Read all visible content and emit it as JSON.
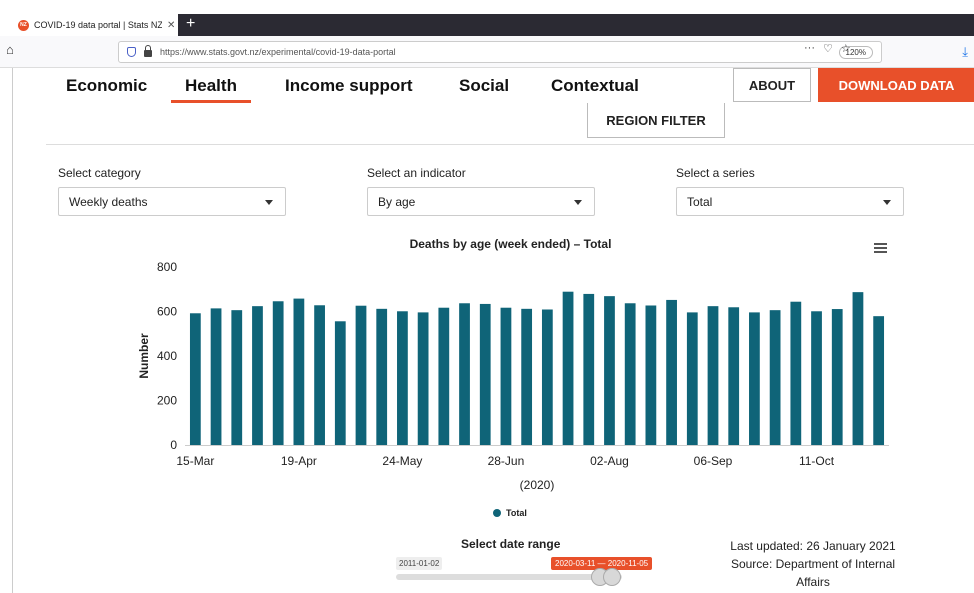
{
  "browser": {
    "tab_title": "COVID-19 data portal | Stats NZ",
    "tab_favicon": "NZ",
    "new_tab": "+",
    "url": "https://www.stats.govt.nz/experimental/covid-19-data-portal",
    "zoom": "120%"
  },
  "nav": {
    "tabs": [
      {
        "label": "Economic"
      },
      {
        "label": "Health",
        "active": true
      },
      {
        "label": "Income support"
      },
      {
        "label": "Social"
      },
      {
        "label": "Contextual"
      }
    ],
    "about": "ABOUT",
    "download": "DOWNLOAD DATA",
    "region_filter": "REGION FILTER"
  },
  "filters": {
    "category": {
      "label": "Select category",
      "value": "Weekly deaths"
    },
    "indicator": {
      "label": "Select an indicator",
      "value": "By age"
    },
    "series": {
      "label": "Select a series",
      "value": "Total"
    }
  },
  "chart_data": {
    "type": "bar",
    "title": "Deaths by age (week ended) – Total",
    "ylabel": "Number",
    "xlabel": "(2020)",
    "ylim": [
      0,
      800
    ],
    "yticks": [
      0,
      200,
      400,
      600,
      800
    ],
    "x_tick_labels": [
      "15-Mar",
      "19-Apr",
      "24-May",
      "28-Jun",
      "02-Aug",
      "06-Sep",
      "11-Oct"
    ],
    "x_tick_positions": [
      0,
      5,
      10,
      15,
      20,
      25,
      30
    ],
    "categories": [
      "15-Mar",
      "22-Mar",
      "29-Mar",
      "05-Apr",
      "12-Apr",
      "19-Apr",
      "26-Apr",
      "03-May",
      "10-May",
      "17-May",
      "24-May",
      "31-May",
      "07-Jun",
      "14-Jun",
      "21-Jun",
      "28-Jun",
      "05-Jul",
      "12-Jul",
      "19-Jul",
      "26-Jul",
      "02-Aug",
      "09-Aug",
      "16-Aug",
      "23-Aug",
      "30-Aug",
      "06-Sep",
      "13-Sep",
      "20-Sep",
      "27-Sep",
      "04-Oct",
      "11-Oct",
      "18-Oct",
      "25-Oct",
      "01-Nov"
    ],
    "series": [
      {
        "name": "Total",
        "color": "#0f6478",
        "values": [
          592,
          614,
          606,
          624,
          646,
          658,
          628,
          556,
          626,
          612,
          601,
          596,
          617,
          637,
          634,
          617,
          612,
          609,
          689,
          679,
          669,
          637,
          627,
          652,
          596,
          624,
          619,
          596,
          606,
          644,
          601,
          611,
          687,
          579
        ]
      }
    ],
    "legend": "bottom-center",
    "grid": false
  },
  "range": {
    "label": "Select date range",
    "start": "2011-01-02",
    "selected": "2020-03-11 — 2020-11-05"
  },
  "footer": {
    "updated": "Last updated: 26 January 2021",
    "source": "Source: Department of Internal Affairs"
  }
}
